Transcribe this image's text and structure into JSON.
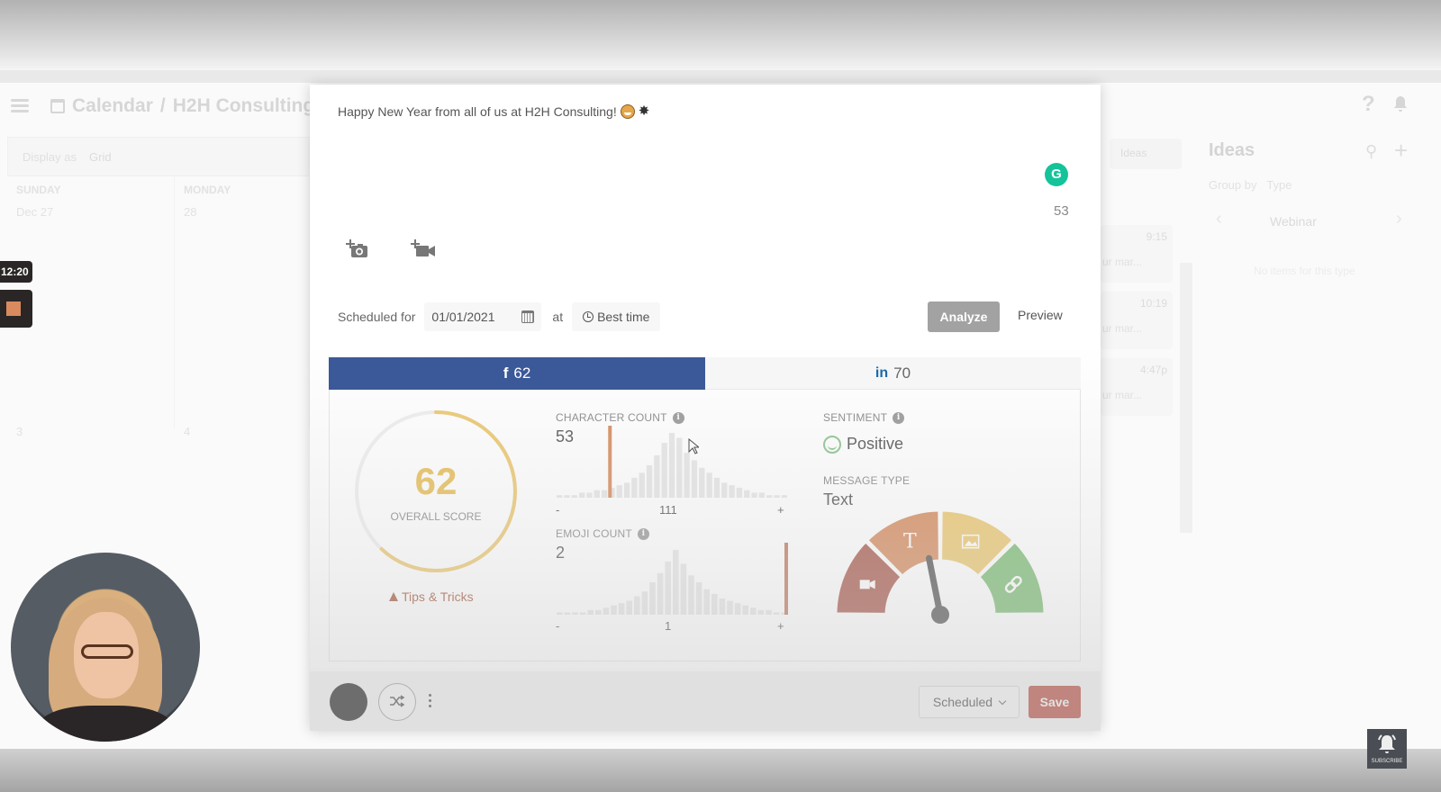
{
  "background_app": {
    "breadcrumb": [
      "Calendar",
      "H2H Consulting"
    ],
    "breadcrumb_separator": "/",
    "display_as_label": "Display as",
    "display_as_value": "Grid",
    "columns": [
      {
        "day": "SUNDAY",
        "date": "Dec 27"
      },
      {
        "day": "MONDAY",
        "date": "28"
      }
    ],
    "row2_dates": [
      "3",
      "4"
    ],
    "ideas_chip": "Ideas",
    "ideas_panel": {
      "title": "Ideas",
      "group_by_label": "Group by",
      "group_by_value": "Type",
      "category": "Webinar",
      "empty_text": "No items for this type"
    },
    "events": [
      {
        "time": "9:15",
        "snippet": "ur mar..."
      },
      {
        "time": "10:19",
        "snippet": "ur mar..."
      },
      {
        "time": "4:47p",
        "snippet": "ur mar..."
      }
    ]
  },
  "recorder": {
    "timer": "12:20",
    "subscribe_label": "SUBSCRIBE"
  },
  "composer": {
    "message": "Happy New Year from all of us at H2H Consulting!",
    "emoji_grin": "grinning-face",
    "emoji_burst": "✸",
    "grammarly_label": "G",
    "char_count": "53",
    "scheduled_for_label": "Scheduled for",
    "date_value": "01/01/2021",
    "at_label": "at",
    "best_time_label": "Best time",
    "analyze_label": "Analyze",
    "preview_label": "Preview"
  },
  "tabs": [
    {
      "network": "facebook",
      "icon": "f",
      "score": "62",
      "active": true
    },
    {
      "network": "linkedin",
      "icon": "in",
      "score": "70",
      "active": false
    }
  ],
  "analysis": {
    "overall_score": "62",
    "overall_score_fraction": 0.62,
    "overall_label": "OVERALL SCORE",
    "tips_label": "Tips & Tricks",
    "character_count": {
      "label": "CHARACTER COUNT",
      "value": "53",
      "axis_min": "-",
      "axis_mid": "111",
      "axis_max": "+",
      "distribution": [
        1,
        1,
        1,
        2,
        2,
        3,
        3,
        4,
        5,
        6,
        8,
        10,
        13,
        17,
        22,
        26,
        24,
        18,
        15,
        12,
        10,
        8,
        6,
        5,
        4,
        3,
        2,
        2,
        1,
        1,
        1
      ],
      "marker_bin": 7
    },
    "emoji_count": {
      "label": "EMOJI COUNT",
      "value": "2",
      "axis_min": "-",
      "axis_mid": "1",
      "axis_max": "+",
      "distribution": [
        1,
        1,
        1,
        1,
        2,
        2,
        3,
        4,
        5,
        6,
        8,
        10,
        14,
        18,
        23,
        28,
        22,
        17,
        14,
        11,
        9,
        7,
        6,
        5,
        4,
        3,
        2,
        2,
        1,
        1
      ],
      "marker_bin": 30
    },
    "sentiment": {
      "label": "SENTIMENT",
      "value": "Positive"
    },
    "message_type": {
      "label": "MESSAGE TYPE",
      "value": "Text",
      "segments": [
        {
          "name": "video",
          "color": "#a95b4e"
        },
        {
          "name": "text",
          "color": "#d68c5f"
        },
        {
          "name": "image",
          "color": "#ecc870"
        },
        {
          "name": "link",
          "color": "#7cbd74"
        }
      ],
      "needle_segment": "text"
    }
  },
  "footer": {
    "status_value": "Scheduled",
    "save_label": "Save"
  },
  "colors": {
    "facebook": "#3b5998",
    "linkedin": "#1b6aa8",
    "score": "#e8bf5a",
    "marker": "#d68c5f",
    "save": "#c0574a",
    "grammarly": "#15c39a"
  }
}
